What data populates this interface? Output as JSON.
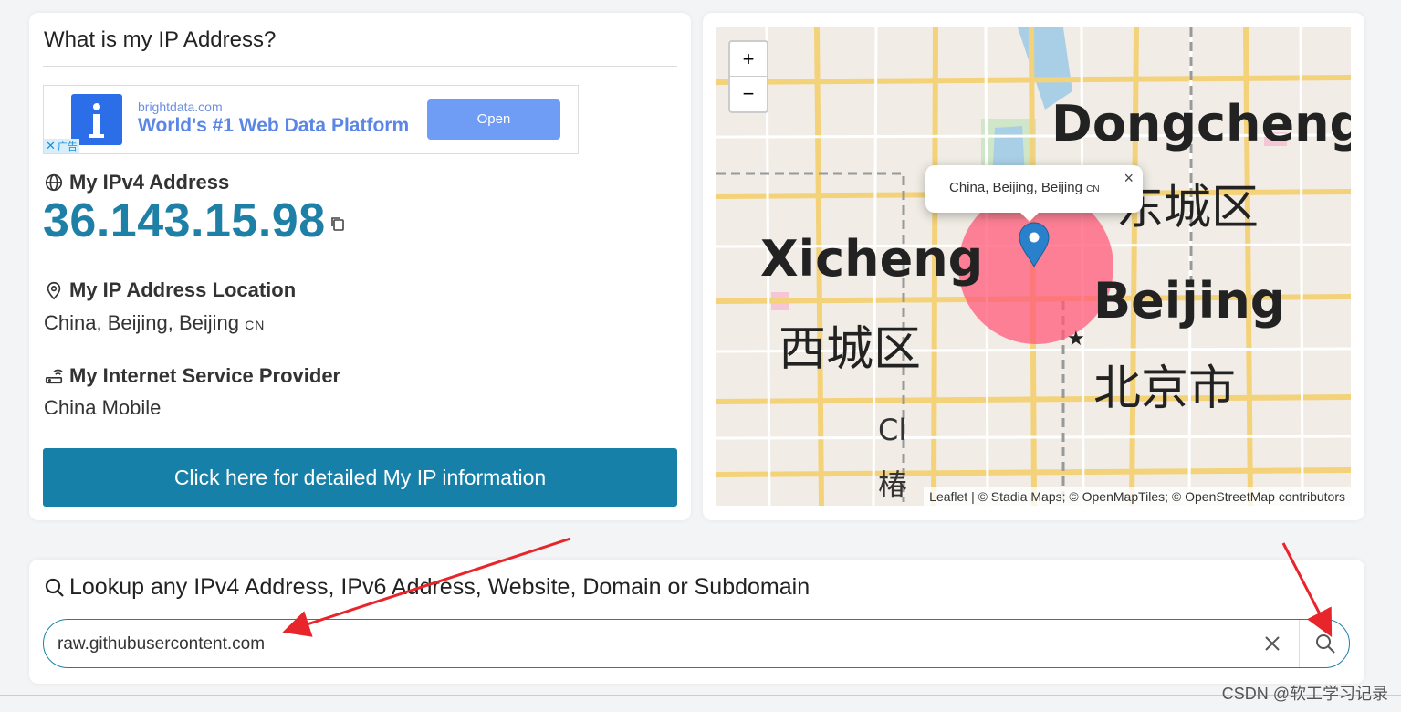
{
  "info": {
    "title": "What is my IP Address?",
    "ad": {
      "domain": "brightdata.com",
      "headline": "World's #1 Web Data Platform",
      "button": "Open",
      "badge": "广告"
    },
    "ipv4_label": "My IPv4 Address",
    "ipv4_value": "36.143.15.98",
    "location_label": "My IP Address Location",
    "location_value": "China, Beijing, Beijing",
    "country_code": "CN",
    "isp_label": "My Internet Service Provider",
    "isp_value": "China Mobile",
    "detail_button": "Click here for detailed My IP information"
  },
  "map": {
    "zoom_in": "+",
    "zoom_out": "−",
    "popup_text": "China, Beijing, Beijing",
    "popup_cc": "CN",
    "popup_close": "×",
    "labels": {
      "dongcheng": "Dongcheng",
      "dongcheng_cn": "东城区",
      "xicheng": "Xicheng",
      "xicheng_cn": "西城区",
      "beijing": "Beijing",
      "beijing_cn": "北京市",
      "partial_1": "Cl",
      "partial_2": "椿"
    },
    "attribution": "Leaflet | © Stadia Maps; © OpenMapTiles; © OpenStreetMap contributors"
  },
  "lookup": {
    "title": "Lookup any IPv4 Address, IPv6 Address, Website, Domain or Subdomain",
    "input_value": "raw.githubusercontent.com"
  },
  "watermark": "CSDN @软工学习记录",
  "colors": {
    "accent": "#1780a9",
    "ip_value": "#1e7fa7",
    "annotation_arrow": "#e8252a",
    "map_circle": "#ff5a7a"
  }
}
